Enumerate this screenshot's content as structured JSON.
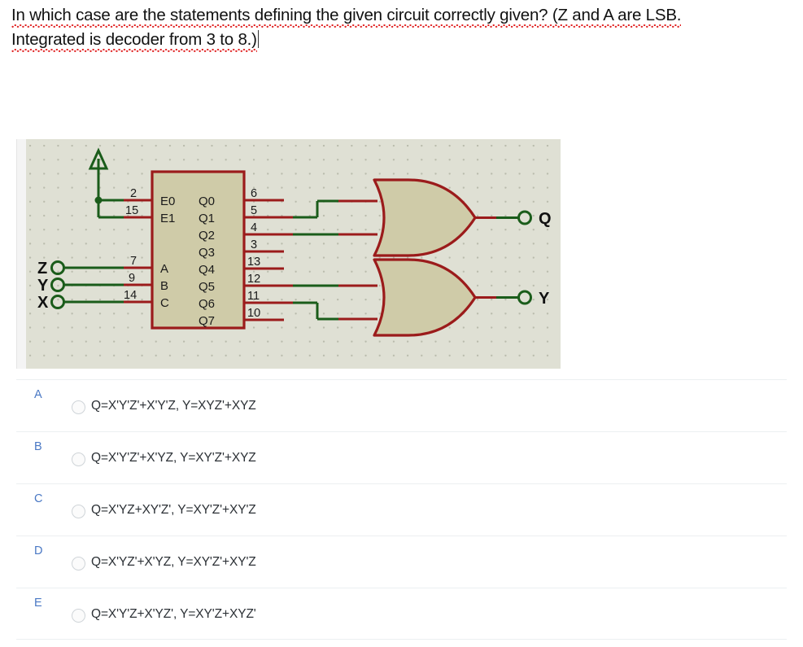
{
  "question": {
    "line1": "In which case are the statements defining the given circuit correctly given? (Z and A are LSB.",
    "line2": "Integrated is decoder from 3 to 8.)"
  },
  "circuit": {
    "canvas_bg": "#dfe0d4",
    "wire_red": "#9b1b1b",
    "wire_green": "#1a5c1a",
    "body_fill": "#cfcba8",
    "power_symbol": "vcc",
    "decoder": {
      "enable_pins": [
        {
          "label": "E0",
          "pin": "2"
        },
        {
          "label": "E1",
          "pin": "15"
        }
      ],
      "select_pins": [
        {
          "label": "A",
          "pin": "7",
          "source": "Z"
        },
        {
          "label": "B",
          "pin": "9",
          "source": "Y"
        },
        {
          "label": "C",
          "pin": "14",
          "source": "X"
        }
      ],
      "outputs": [
        {
          "label": "Q0",
          "pin": "6",
          "connected_to": ""
        },
        {
          "label": "Q1",
          "pin": "5",
          "connected_to": "gate-q"
        },
        {
          "label": "Q2",
          "pin": "4",
          "connected_to": "gate-q"
        },
        {
          "label": "Q3",
          "pin": "3",
          "connected_to": ""
        },
        {
          "label": "Q4",
          "pin": "13",
          "connected_to": ""
        },
        {
          "label": "Q5",
          "pin": "12",
          "connected_to": "gate-y"
        },
        {
          "label": "Q6",
          "pin": "11",
          "connected_to": "gate-y"
        },
        {
          "label": "Q7",
          "pin": "10",
          "connected_to": ""
        }
      ]
    },
    "input_terminals": [
      {
        "label": "Z"
      },
      {
        "label": "Y"
      },
      {
        "label": "X"
      }
    ],
    "gates": [
      {
        "name": "gate-q",
        "type": "OR",
        "output_label": "Q"
      },
      {
        "name": "gate-y",
        "type": "OR",
        "output_label": "Y"
      }
    ],
    "output_terminals": [
      {
        "label": "Q"
      },
      {
        "label": "Y"
      }
    ]
  },
  "options": [
    {
      "letter": "A",
      "text": "Q=X'Y'Z'+X'Y'Z, Y=XYZ'+XYZ",
      "selected": false
    },
    {
      "letter": "B",
      "text": "Q=X'Y'Z'+X'YZ, Y=XY'Z'+XYZ",
      "selected": false
    },
    {
      "letter": "C",
      "text": "Q=X'YZ+XY'Z', Y=XY'Z'+XY'Z",
      "selected": false
    },
    {
      "letter": "D",
      "text": "Q=X'YZ'+X'YZ, Y=XY'Z'+XY'Z",
      "selected": false
    },
    {
      "letter": "E",
      "text": "Q=X'Y'Z+X'YZ', Y=XY'Z+XYZ'",
      "selected": false
    }
  ]
}
